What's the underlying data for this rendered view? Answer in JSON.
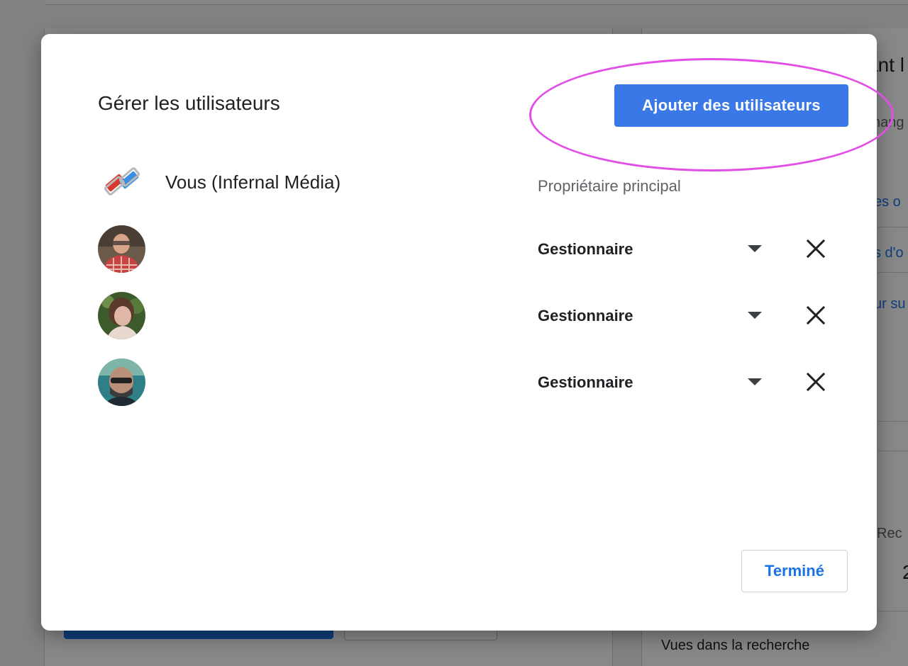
{
  "dialog": {
    "title": "Gérer les utilisateurs",
    "add_users_label": "Ajouter des utilisateurs",
    "done_label": "Terminé",
    "highlight_color": "#e34ee6",
    "accent_color": "#3b78e7"
  },
  "users": [
    {
      "name": "Vous (Infernal Média)",
      "role": "Propriétaire principal",
      "avatar": "infernal-media-logo",
      "editable": false
    },
    {
      "name": "",
      "role": "Gestionnaire",
      "avatar": "user-photo-1",
      "editable": true,
      "dropdown_icon": "caret-down-icon",
      "remove_icon": "close-icon"
    },
    {
      "name": "",
      "role": "Gestionnaire",
      "avatar": "user-photo-2",
      "editable": true,
      "dropdown_icon": "caret-down-icon",
      "remove_icon": "close-icon"
    },
    {
      "name": "",
      "role": "Gestionnaire",
      "avatar": "user-photo-3",
      "editable": true,
      "dropdown_icon": "caret-down-icon",
      "remove_icon": "close-icon"
    }
  ],
  "background": {
    "heading_fragment": "ant l",
    "text_fragment_1": "hang",
    "link_fragment_1": "es o",
    "link_fragment_2": "s d'o",
    "link_fragment_3": "ur su",
    "stat_label_fragment": "Rec",
    "stat_value_fragment": "2",
    "footer_text": "Vues dans la recherche"
  }
}
